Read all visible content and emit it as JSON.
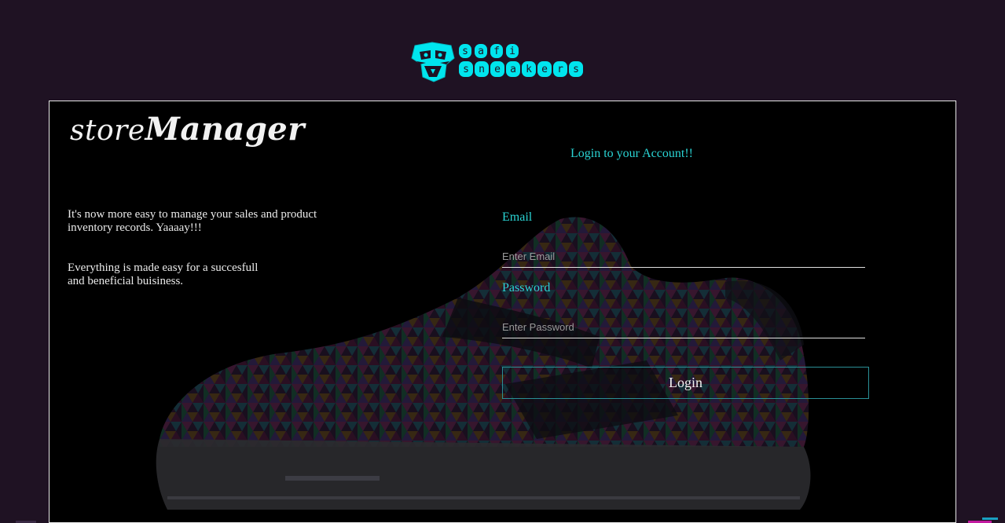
{
  "brand": {
    "logo_text": "safi sneakers"
  },
  "store_logo": {
    "part1": "store",
    "part2": "Manager"
  },
  "intro": {
    "line1": "It's now more easy to manage your sales and product inventory records. Yaaaay!!!",
    "line2": "Everything is made easy for a succesfull and beneficial buisiness."
  },
  "login": {
    "title": "Login to your Account!!",
    "email_label": "Email",
    "email_placeholder": "Enter Email",
    "password_label": "Password",
    "password_placeholder": "Enter Password",
    "button_label": "Login"
  },
  "colors": {
    "page_background": "#1f1223",
    "panel_background": "#000000",
    "accent_cyan": "#2ad4d4",
    "logo_cyan": "#00e5ee",
    "button_border": "#2a8f96",
    "text_light": "#eaeaea"
  },
  "icons": {
    "brand": "safi-sneakers-logo",
    "background": "sneaker-image"
  }
}
